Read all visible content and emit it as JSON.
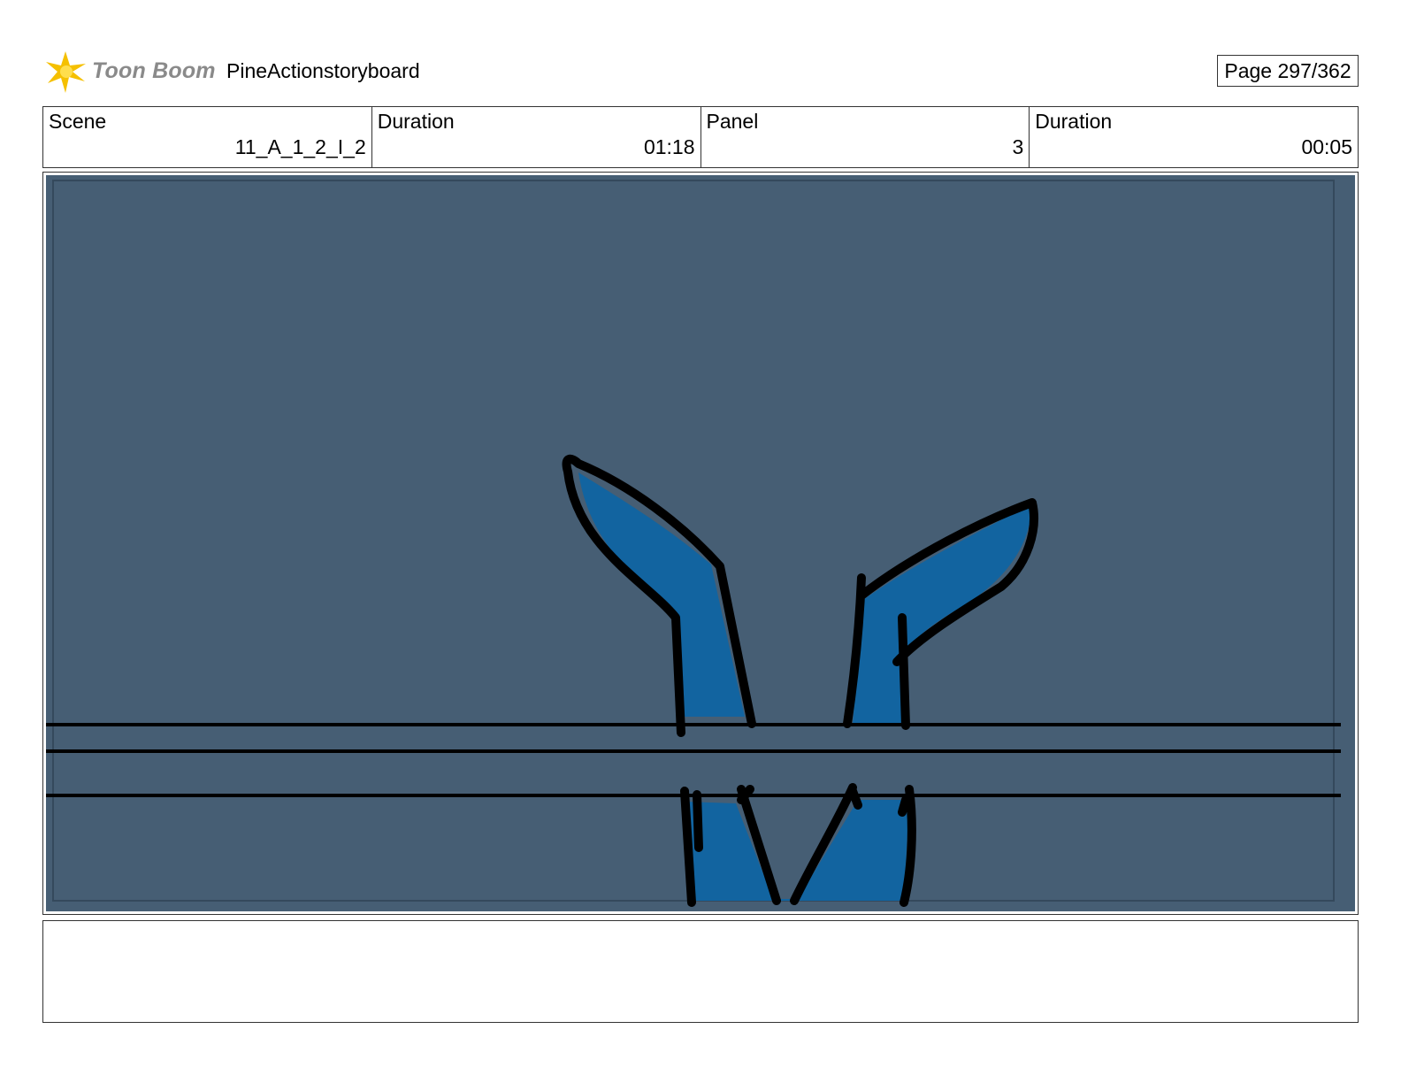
{
  "header": {
    "logo_text": "Toon Boom",
    "project_title": "PineActionstoryboard",
    "page_label": "Page 297/362"
  },
  "info": [
    {
      "label": "Scene",
      "value": "11_A_1_2_I_2"
    },
    {
      "label": "Duration",
      "value": "01:18"
    },
    {
      "label": "Panel",
      "value": "3"
    },
    {
      "label": "Duration",
      "value": "00:05"
    }
  ],
  "notes": {
    "text": ""
  },
  "colors": {
    "panel_background": "#465e74",
    "fill_blue": "#1264a0",
    "ink": "#000000",
    "logo_star": "#f5c000"
  }
}
